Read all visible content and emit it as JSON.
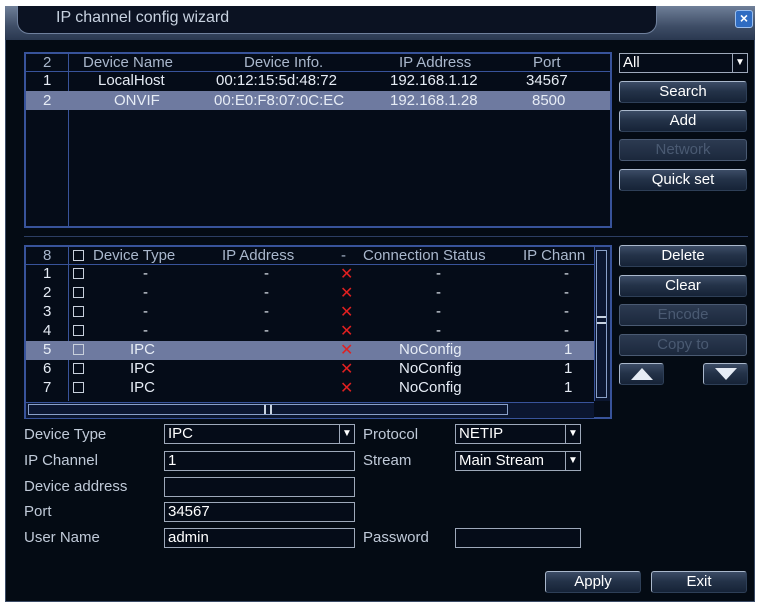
{
  "window": {
    "title": "IP channel config wizard",
    "close_glyph": "×"
  },
  "search_list": {
    "columns": [
      "2",
      "Device Name",
      "Device Info.",
      "IP Address",
      "Port"
    ],
    "rows": [
      {
        "num": "1",
        "name": "LocalHost",
        "info": "00:12:15:5d:48:72",
        "ip": "192.168.1.12",
        "port": "34567"
      },
      {
        "num": "2",
        "name": "ONVIF",
        "info": "00:E0:F8:07:0C:EC",
        "ip": "192.168.1.28",
        "port": "8500"
      }
    ],
    "selected_index": 1
  },
  "filter": {
    "value": "All"
  },
  "buttons_top": {
    "search": "Search",
    "add": "Add",
    "network": "Network",
    "quick_set": "Quick set"
  },
  "channel_list": {
    "columns": [
      "8",
      "Device Type",
      "IP Address",
      "-",
      "Connection Status",
      "IP Chann"
    ],
    "rows": [
      {
        "num": "1",
        "type": "-",
        "ip": "-",
        "status": "-",
        "chan": "-"
      },
      {
        "num": "2",
        "type": "-",
        "ip": "-",
        "status": "-",
        "chan": "-"
      },
      {
        "num": "3",
        "type": "-",
        "ip": "-",
        "status": "-",
        "chan": "-"
      },
      {
        "num": "4",
        "type": "-",
        "ip": "-",
        "status": "-",
        "chan": "-"
      },
      {
        "num": "5",
        "type": "IPC",
        "ip": "",
        "status": "NoConfig",
        "chan": "1"
      },
      {
        "num": "6",
        "type": "IPC",
        "ip": "",
        "status": "NoConfig",
        "chan": "1"
      },
      {
        "num": "7",
        "type": "IPC",
        "ip": "",
        "status": "NoConfig",
        "chan": "1"
      }
    ],
    "selected_index": 4,
    "status_mark": "✕"
  },
  "buttons_side": {
    "delete": "Delete",
    "clear": "Clear",
    "encode": "Encode",
    "copy_to": "Copy to"
  },
  "form": {
    "device_type_label": "Device Type",
    "device_type_value": "IPC",
    "protocol_label": "Protocol",
    "protocol_value": "NETIP",
    "ip_channel_label": "IP Channel",
    "ip_channel_value": "1",
    "stream_label": "Stream",
    "stream_value": "Main Stream",
    "device_address_label": "Device address",
    "device_address_value": "",
    "port_label": "Port",
    "port_value": "34567",
    "user_name_label": "User Name",
    "user_name_value": "admin",
    "password_label": "Password",
    "password_value": ""
  },
  "footer": {
    "apply": "Apply",
    "exit": "Exit"
  },
  "icons": {
    "dropdown": "triangle-down-icon",
    "up": "arrow-up-icon",
    "down": "arrow-down-icon",
    "close": "close-icon"
  },
  "colors": {
    "selection": "#6e7aa0",
    "panel_border": "#38539a",
    "status_mark": "#e02020"
  }
}
